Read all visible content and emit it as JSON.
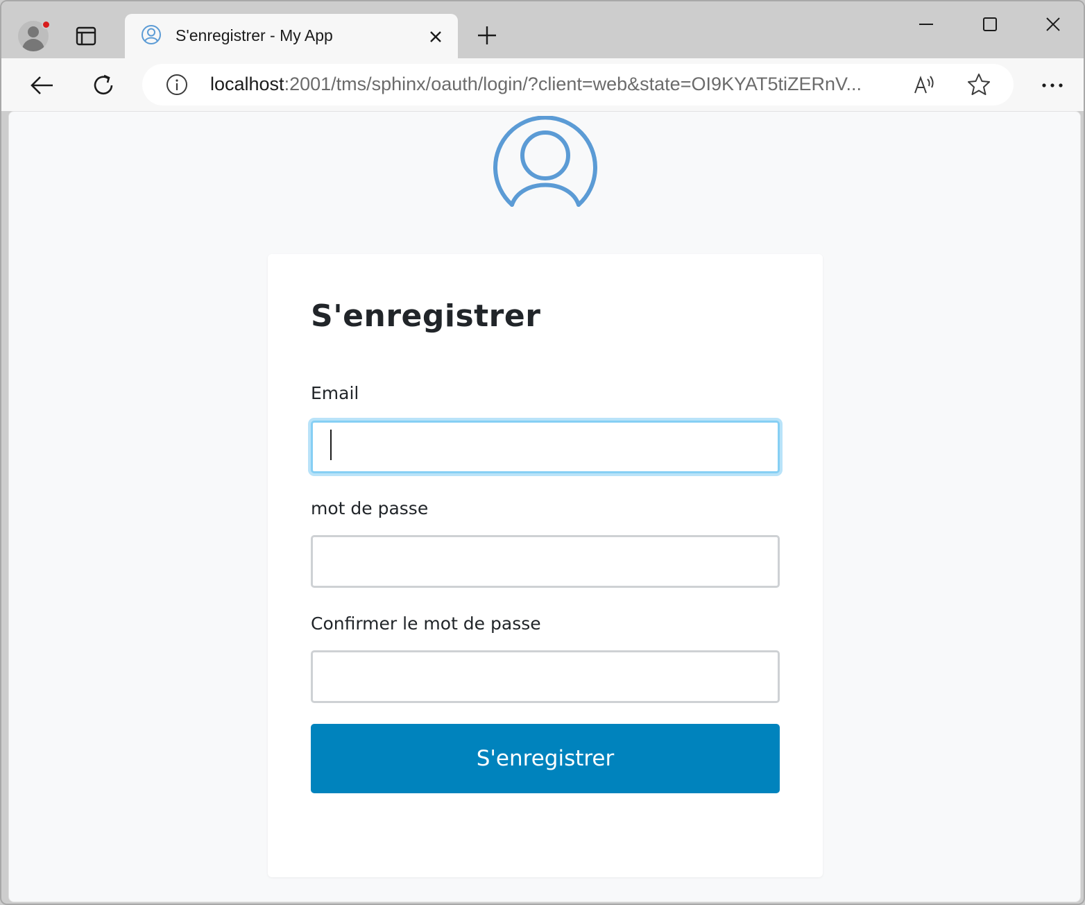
{
  "browser": {
    "tab": {
      "title": "S'enregistrer - My App",
      "favicon": "user-circle-icon"
    },
    "address": {
      "host": "localhost",
      "rest": ":2001/tms/sphinx/oauth/login/?client=web&state=OI9KYAT5tiZERnV..."
    },
    "icons": {
      "profile": "profile-avatar-icon",
      "tab_actions": "tab-actions-icon",
      "new_tab": "plus-icon",
      "back": "arrow-left-icon",
      "reload": "reload-icon",
      "info": "info-icon",
      "read_aloud": "read-aloud-icon",
      "favorite": "star-icon",
      "more": "more-dots-icon"
    },
    "colors": {
      "frame": "#cdcdcd",
      "toolbar": "#f7f7f7",
      "profile_dot": "#d81c1c"
    }
  },
  "page": {
    "logo": "user-circle-icon",
    "title": "S'enregistrer",
    "fields": {
      "email": {
        "label": "Email",
        "value": ""
      },
      "password": {
        "label": "mot de passe",
        "value": ""
      },
      "confirm": {
        "label": "Confirmer le mot de passe",
        "value": ""
      }
    },
    "submit_label": "S'enregistrer",
    "colors": {
      "accent": "#0083bd",
      "logo": "#5b9bd5",
      "focus": "#86cff4",
      "background": "#f8f9fa"
    }
  }
}
